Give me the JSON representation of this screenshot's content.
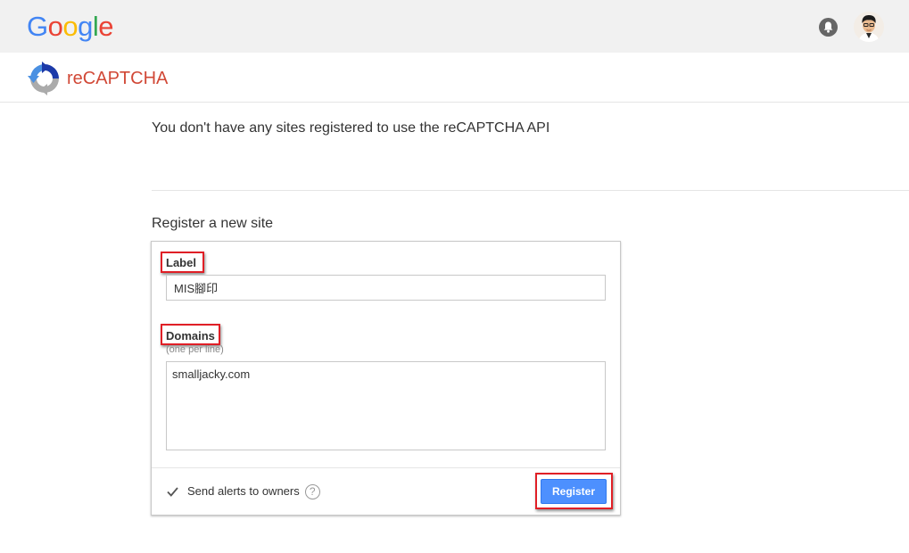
{
  "header": {
    "google_logo": {
      "letters": [
        "G",
        "o",
        "o",
        "g",
        "l",
        "e"
      ],
      "colors": [
        "#4285f4",
        "#ea4335",
        "#fbbc05",
        "#4285f4",
        "#34a853",
        "#ea4335"
      ]
    },
    "icons": [
      "notifications-bell-icon",
      "user-avatar"
    ]
  },
  "product": {
    "title": "reCAPTCHA",
    "title_color": "#d14836",
    "logo_icon": "recaptcha-logo-icon"
  },
  "main": {
    "no_sites_message": "You don't have any sites registered to use the reCAPTCHA API",
    "register_heading": "Register a new site"
  },
  "form": {
    "label_field": {
      "label": "Label",
      "value": "MIS腳印"
    },
    "domains_field": {
      "label": "Domains",
      "hint": "(one per line)",
      "value": "smalljacky.com"
    },
    "alerts_checkbox": {
      "label": "Send alerts to owners",
      "checked": true,
      "help_glyph": "?"
    },
    "submit": {
      "label": "Register",
      "color": "#4d90fe"
    },
    "highlight_color": "#e01f26"
  }
}
